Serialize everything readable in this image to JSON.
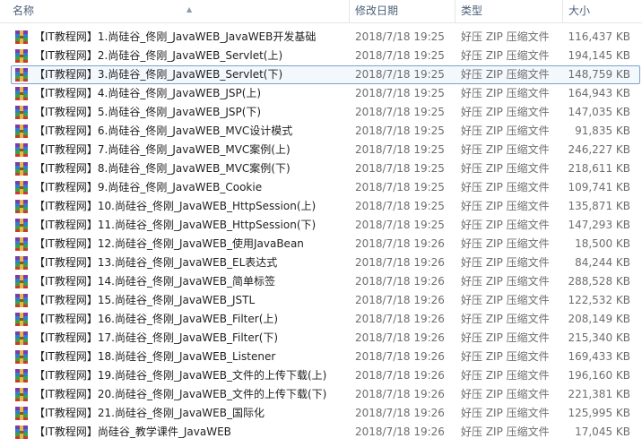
{
  "columns": {
    "name": "名称",
    "date": "修改日期",
    "type": "类型",
    "size": "大小"
  },
  "colors": {
    "header_text": "#4c607a",
    "selection_border": "#7da2ce",
    "selection_fill": "#f3f8fd"
  },
  "icon": "winrar-archive-icon",
  "selected_index": 2,
  "files": [
    {
      "name": "【IT教程网】1.尚硅谷_佟刚_JavaWEB_JavaWEB开发基础",
      "date": "2018/7/18 19:25",
      "type": "好压 ZIP 压缩文件",
      "size": "116,437 KB"
    },
    {
      "name": "【IT教程网】2.尚硅谷_佟刚_JavaWEB_Servlet(上)",
      "date": "2018/7/18 19:25",
      "type": "好压 ZIP 压缩文件",
      "size": "194,145 KB"
    },
    {
      "name": "【IT教程网】3.尚硅谷_佟刚_JavaWEB_Servlet(下)",
      "date": "2018/7/18 19:25",
      "type": "好压 ZIP 压缩文件",
      "size": "148,759 KB"
    },
    {
      "name": "【IT教程网】4.尚硅谷_佟刚_JavaWEB_JSP(上)",
      "date": "2018/7/18 19:25",
      "type": "好压 ZIP 压缩文件",
      "size": "164,943 KB"
    },
    {
      "name": "【IT教程网】5.尚硅谷_佟刚_JavaWEB_JSP(下)",
      "date": "2018/7/18 19:25",
      "type": "好压 ZIP 压缩文件",
      "size": "147,035 KB"
    },
    {
      "name": "【IT教程网】6.尚硅谷_佟刚_JavaWEB_MVC设计模式",
      "date": "2018/7/18 19:25",
      "type": "好压 ZIP 压缩文件",
      "size": "91,835 KB"
    },
    {
      "name": "【IT教程网】7.尚硅谷_佟刚_JavaWEB_MVC案例(上)",
      "date": "2018/7/18 19:25",
      "type": "好压 ZIP 压缩文件",
      "size": "246,227 KB"
    },
    {
      "name": "【IT教程网】8.尚硅谷_佟刚_JavaWEB_MVC案例(下)",
      "date": "2018/7/18 19:25",
      "type": "好压 ZIP 压缩文件",
      "size": "218,611 KB"
    },
    {
      "name": "【IT教程网】9.尚硅谷_佟刚_JavaWEB_Cookie",
      "date": "2018/7/18 19:25",
      "type": "好压 ZIP 压缩文件",
      "size": "109,741 KB"
    },
    {
      "name": "【IT教程网】10.尚硅谷_佟刚_JavaWEB_HttpSession(上)",
      "date": "2018/7/18 19:25",
      "type": "好压 ZIP 压缩文件",
      "size": "135,871 KB"
    },
    {
      "name": "【IT教程网】11.尚硅谷_佟刚_JavaWEB_HttpSession(下)",
      "date": "2018/7/18 19:25",
      "type": "好压 ZIP 压缩文件",
      "size": "147,293 KB"
    },
    {
      "name": "【IT教程网】12.尚硅谷_佟刚_JavaWEB_使用JavaBean",
      "date": "2018/7/18 19:26",
      "type": "好压 ZIP 压缩文件",
      "size": "18,500 KB"
    },
    {
      "name": "【IT教程网】13.尚硅谷_佟刚_JavaWEB_EL表达式",
      "date": "2018/7/18 19:26",
      "type": "好压 ZIP 压缩文件",
      "size": "84,244 KB"
    },
    {
      "name": "【IT教程网】14.尚硅谷_佟刚_JavaWEB_简单标签",
      "date": "2018/7/18 19:26",
      "type": "好压 ZIP 压缩文件",
      "size": "288,528 KB"
    },
    {
      "name": "【IT教程网】15.尚硅谷_佟刚_JavaWEB_JSTL",
      "date": "2018/7/18 19:26",
      "type": "好压 ZIP 压缩文件",
      "size": "122,532 KB"
    },
    {
      "name": "【IT教程网】16.尚硅谷_佟刚_JavaWEB_Filter(上)",
      "date": "2018/7/18 19:26",
      "type": "好压 ZIP 压缩文件",
      "size": "208,149 KB"
    },
    {
      "name": "【IT教程网】17.尚硅谷_佟刚_JavaWEB_Filter(下)",
      "date": "2018/7/18 19:26",
      "type": "好压 ZIP 压缩文件",
      "size": "215,340 KB"
    },
    {
      "name": "【IT教程网】18.尚硅谷_佟刚_JavaWEB_Listener",
      "date": "2018/7/18 19:26",
      "type": "好压 ZIP 压缩文件",
      "size": "169,433 KB"
    },
    {
      "name": "【IT教程网】19.尚硅谷_佟刚_JavaWEB_文件的上传下载(上)",
      "date": "2018/7/18 19:26",
      "type": "好压 ZIP 压缩文件",
      "size": "196,160 KB"
    },
    {
      "name": "【IT教程网】20.尚硅谷_佟刚_JavaWEB_文件的上传下载(下)",
      "date": "2018/7/18 19:26",
      "type": "好压 ZIP 压缩文件",
      "size": "221,381 KB"
    },
    {
      "name": "【IT教程网】21.尚硅谷_佟刚_JavaWEB_国际化",
      "date": "2018/7/18 19:26",
      "type": "好压 ZIP 压缩文件",
      "size": "125,995 KB"
    },
    {
      "name": "【IT教程网】尚硅谷_教学课件_JavaWEB",
      "date": "2018/7/18 19:26",
      "type": "好压 ZIP 压缩文件",
      "size": "17,045 KB"
    }
  ]
}
